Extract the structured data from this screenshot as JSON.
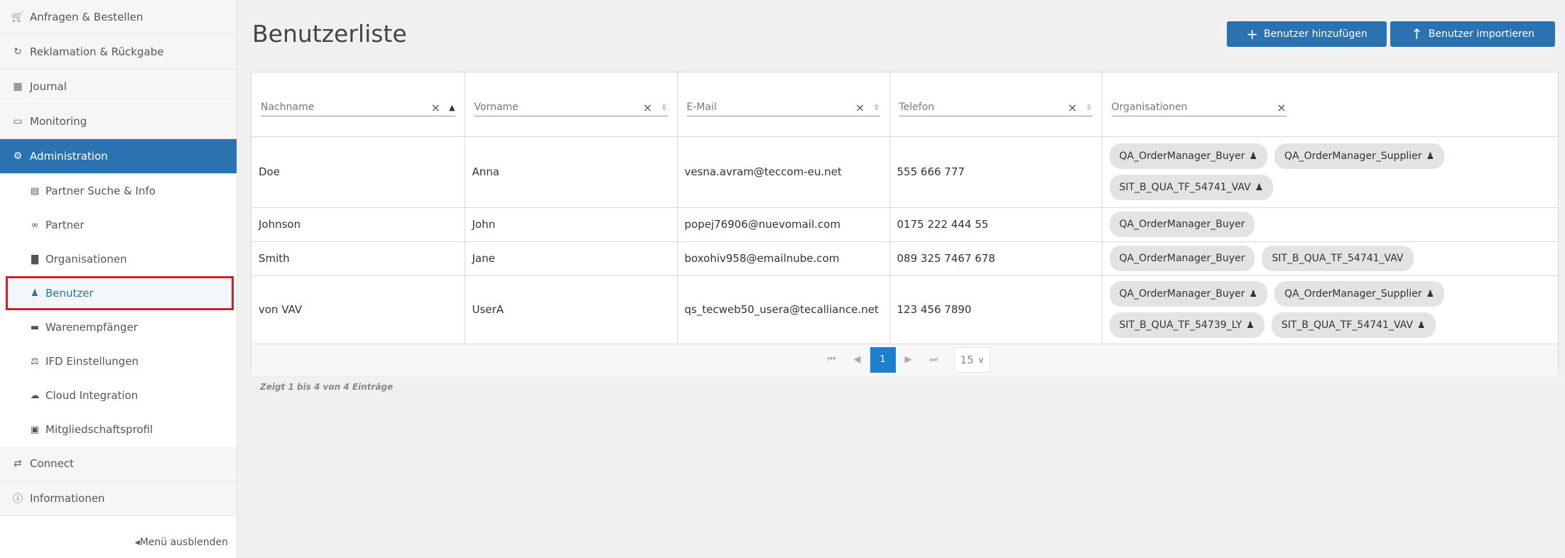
{
  "sidebar": {
    "items": [
      {
        "label": "Anfragen & Bestellen",
        "icon": "cart-icon"
      },
      {
        "label": "Reklamation & Rückgabe",
        "icon": "refresh-icon"
      },
      {
        "label": "Journal",
        "icon": "table-icon"
      },
      {
        "label": "Monitoring",
        "icon": "monitor-icon"
      },
      {
        "label": "Administration",
        "icon": "gear-icon"
      }
    ],
    "sub_items": [
      {
        "label": "Partner Suche & Info",
        "icon": "briefcase-icon"
      },
      {
        "label": "Partner",
        "icon": "handshake-icon"
      },
      {
        "label": "Organisationen",
        "icon": "bar-chart-icon"
      },
      {
        "label": "Benutzer",
        "icon": "users-icon"
      },
      {
        "label": "Warenempfänger",
        "icon": "truck-icon"
      },
      {
        "label": "IFD Einstellungen",
        "icon": "scale-icon"
      },
      {
        "label": "Cloud Integration",
        "icon": "cloud-icon"
      },
      {
        "label": "Mitgliedschaftsprofil",
        "icon": "id-card-icon"
      }
    ],
    "bottom_items": [
      {
        "label": "Connect",
        "icon": "exchange-icon"
      },
      {
        "label": "Informationen",
        "icon": "info-icon"
      }
    ],
    "toggle_label": "Menü ausblenden"
  },
  "page": {
    "title": "Benutzerliste"
  },
  "toolbar": {
    "add_label": "Benutzer hinzufügen",
    "import_label": "Benutzer importieren"
  },
  "table": {
    "columns": [
      {
        "placeholder": "Nachname",
        "sort": "asc"
      },
      {
        "placeholder": "Vorname",
        "sort": "both"
      },
      {
        "placeholder": "E-Mail",
        "sort": "both"
      },
      {
        "placeholder": "Telefon",
        "sort": "both"
      },
      {
        "placeholder": "Organisationen",
        "sort": "none"
      }
    ],
    "rows": [
      {
        "nachname": "Doe",
        "vorname": "Anna",
        "email": "vesna.avram@teccom-eu.net",
        "telefon": "555 666 777",
        "orgs": [
          {
            "name": "QA_OrderManager_Buyer",
            "icon": true
          },
          {
            "name": "QA_OrderManager_Supplier",
            "icon": true
          },
          {
            "name": "SIT_B_QUA_TF_54741_VAV",
            "icon": true
          }
        ]
      },
      {
        "nachname": "Johnson",
        "vorname": "John",
        "email": "popej76906@nuevomail.com",
        "telefon": "0175 222 444 55",
        "orgs": [
          {
            "name": "QA_OrderManager_Buyer",
            "icon": false
          }
        ]
      },
      {
        "nachname": "Smith",
        "vorname": "Jane",
        "email": "boxohiv958@emailnube.com",
        "telefon": "089 325 7467 678",
        "orgs": [
          {
            "name": "QA_OrderManager_Buyer",
            "icon": false
          },
          {
            "name": "SIT_B_QUA_TF_54741_VAV",
            "icon": false
          }
        ]
      },
      {
        "nachname": "von VAV",
        "vorname": "UserA",
        "email": "qs_tecweb50_usera@tecalliance.net",
        "telefon": "123 456 7890",
        "orgs": [
          {
            "name": "QA_OrderManager_Buyer",
            "icon": true
          },
          {
            "name": "QA_OrderManager_Supplier",
            "icon": true
          },
          {
            "name": "SIT_B_QUA_TF_54739_LY",
            "icon": true
          },
          {
            "name": "SIT_B_QUA_TF_54741_VAV",
            "icon": true
          }
        ]
      }
    ]
  },
  "pagination": {
    "current_page": "1",
    "page_size": "15"
  },
  "info": {
    "text": "Zeigt 1 bis 4 von 4 Einträge"
  },
  "colors": {
    "accent": "#2a72b0",
    "highlight_border": "#d0212a",
    "page_current": "#1d7fd0"
  }
}
